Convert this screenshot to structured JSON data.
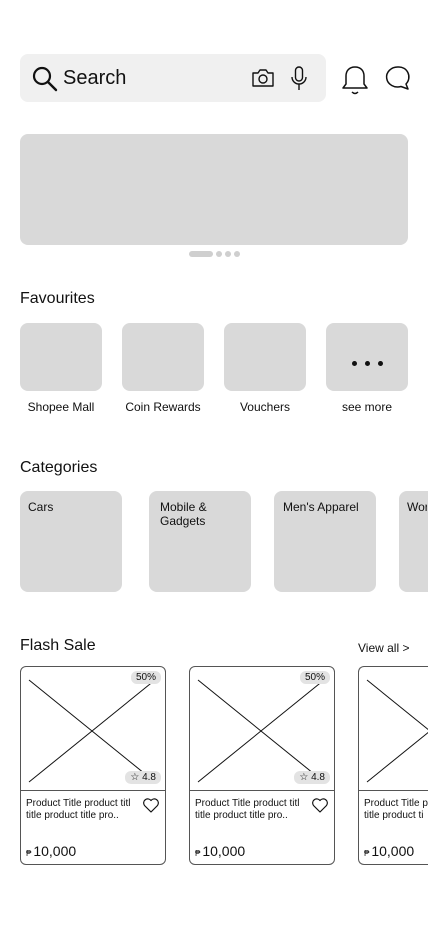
{
  "search": {
    "label": "Search"
  },
  "favourites": {
    "title": "Favourites",
    "items": [
      {
        "label": "Shopee Mall"
      },
      {
        "label": "Coin Rewards"
      },
      {
        "label": "Vouchers"
      },
      {
        "label": "see more"
      }
    ]
  },
  "categories": {
    "title": "Categories",
    "items": [
      {
        "label": "Cars"
      },
      {
        "label": "Mobile & Gadgets"
      },
      {
        "label": "Men's Apparel"
      },
      {
        "label": "Wor"
      }
    ]
  },
  "flash_sale": {
    "title": "Flash Sale",
    "view_all": "View all >",
    "products": [
      {
        "discount": "50%",
        "rating": "☆ 4.8",
        "title": "Product Title product titl\ntitle product title pro..",
        "currency": "₱",
        "price": "10,000"
      },
      {
        "discount": "50%",
        "rating": "☆ 4.8",
        "title": "Product Title product titl\ntitle product title pro..",
        "currency": "₱",
        "price": "10,000"
      },
      {
        "title": "Product Title p\ntitle product ti",
        "currency": "₱",
        "price": "10,000"
      }
    ]
  }
}
